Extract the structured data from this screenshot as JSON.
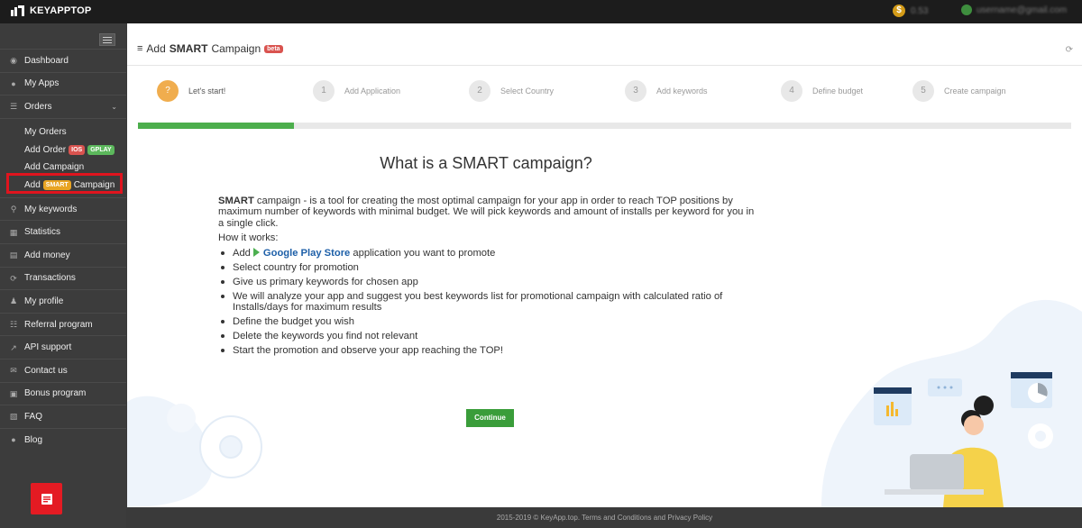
{
  "brand": {
    "name": "KEYAPPTOP"
  },
  "topbar": {
    "balance": "0.53",
    "user": "username@gmail.com"
  },
  "sidebar": {
    "items": [
      {
        "label": "Dashboard",
        "icon": "speedometer-icon"
      },
      {
        "label": "My Apps",
        "icon": "apple-icon"
      },
      {
        "label": "Orders",
        "icon": "list-icon"
      }
    ],
    "orders_sub": {
      "my_orders": "My Orders",
      "add_order": "Add Order",
      "ios_badge": "IOS",
      "gplay_badge": "GPLAY",
      "add_campaign": "Add Campaign",
      "add_smart_prefix": "Add",
      "smart_badge": "SMART",
      "add_smart_suffix": "Campaign"
    },
    "items_after": [
      {
        "label": "My keywords",
        "icon": "key-icon"
      },
      {
        "label": "Statistics",
        "icon": "table-icon"
      },
      {
        "label": "Add money",
        "icon": "money-icon"
      },
      {
        "label": "Transactions",
        "icon": "transactions-icon"
      },
      {
        "label": "My profile",
        "icon": "user-icon"
      },
      {
        "label": "Referral program",
        "icon": "sitemap-icon"
      },
      {
        "label": "API support",
        "icon": "external-link-icon"
      },
      {
        "label": "Contact us",
        "icon": "envelope-icon"
      },
      {
        "label": "Bonus program",
        "icon": "gift-icon"
      },
      {
        "label": "FAQ",
        "icon": "book-icon"
      },
      {
        "label": "Blog",
        "icon": "comments-icon"
      }
    ]
  },
  "page": {
    "title_prefix": "Add",
    "title_bold": "SMART",
    "title_suffix": "Campaign",
    "beta": "beta"
  },
  "steps": [
    {
      "num": "?",
      "label": "Let's start!",
      "active": true
    },
    {
      "num": "1",
      "label": "Add Application",
      "active": false
    },
    {
      "num": "2",
      "label": "Select Country",
      "active": false
    },
    {
      "num": "3",
      "label": "Add keywords",
      "active": false
    },
    {
      "num": "4",
      "label": "Define budget",
      "active": false
    },
    {
      "num": "5",
      "label": "Create campaign",
      "active": false
    }
  ],
  "progress": {
    "fraction": 0.167,
    "color": "#4cae4c"
  },
  "content": {
    "heading": "What is a SMART campaign?",
    "intro_bold": "SMART",
    "intro_rest": " campaign - is a tool for creating the most optimal campaign for your app in order to reach TOP positions by maximum number of keywords with minimal budget. We will pick keywords and amount of installs per keyword for you in a single click.",
    "how": "How it works:",
    "bullet1_pre": "Add",
    "bullet1_store": "Google Play Store",
    "bullet1_post": " application you want to promote",
    "bullets": [
      "Select country for promotion",
      "Give us primary keywords for chosen app",
      "We will analyze your app and suggest you best keywords list for promotional campaign with calculated ratio of Installs/days for maximum results",
      "Define the budget you wish",
      "Delete the keywords you find not relevant",
      "Start the promotion and observe your app reaching the TOP!"
    ],
    "continue": "Continue"
  },
  "footer": "2015-2019 © KeyApp.top. Terms and Conditions and Privacy Policy",
  "colors": {
    "accent": "#f0ad4e",
    "green": "#3a9d3a",
    "highlight": "#e0141e",
    "sidebar": "#3c3c3c"
  }
}
